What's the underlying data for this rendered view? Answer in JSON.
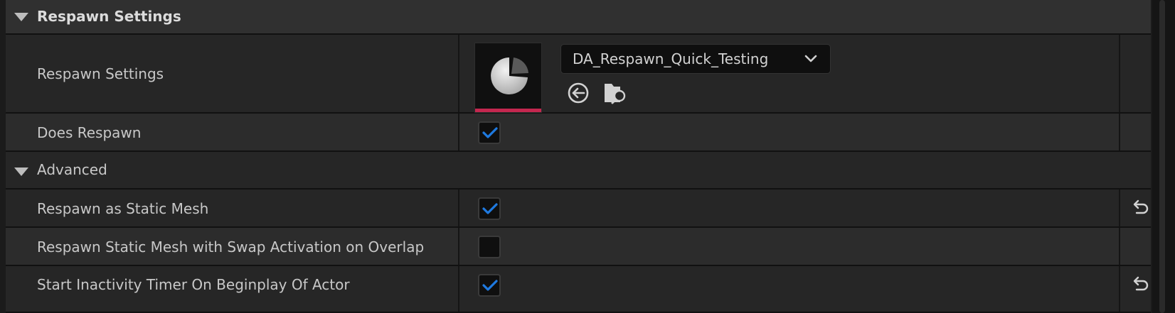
{
  "sections": {
    "respawn": {
      "title": "Respawn Settings"
    },
    "advanced": {
      "title": "Advanced"
    }
  },
  "properties": {
    "respawn_settings": {
      "label": "Respawn Settings",
      "asset": "DA_Respawn_Quick_Testing"
    },
    "does_respawn": {
      "label": "Does Respawn",
      "checked": true
    },
    "respawn_static_mesh": {
      "label": "Respawn as Static Mesh",
      "checked": true
    },
    "swap_activation": {
      "label": "Respawn Static Mesh with  Swap Activation on Overlap",
      "checked": false
    },
    "inactivity_timer": {
      "label": "Start Inactivity Timer On Beginplay Of Actor",
      "checked": true
    }
  },
  "icons": {
    "collapse": "triangle-down-icon",
    "dropdown": "chevron-down-icon",
    "use_selected": "arrow-left-circle-icon",
    "browse": "folder-search-icon",
    "reset": "reset-arrow-icon",
    "check": "checkmark-icon",
    "asset_thumbnail": "data-asset-pie-icon"
  },
  "colors": {
    "accent": "#1f7ae0",
    "asset_type": "#c4274f",
    "panel": "#262626",
    "header": "#303030"
  }
}
